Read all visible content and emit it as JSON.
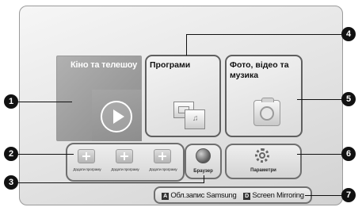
{
  "tiles": {
    "movies": {
      "title": "Кіно та телешоу"
    },
    "apps": {
      "title": "Програми"
    },
    "photos": {
      "title": "Фото, відео та музика"
    }
  },
  "add_apps": [
    {
      "label": "Додати програму"
    },
    {
      "label": "Додати програму"
    },
    {
      "label": "Додати програму"
    }
  ],
  "browser": {
    "label": "Браузер"
  },
  "settings": {
    "label": "Параметри"
  },
  "bottom_bar": {
    "item_a": {
      "key": "A",
      "label": "Обл.запис Samsung"
    },
    "item_d": {
      "key": "D",
      "label": "Screen Mirroring"
    }
  },
  "callouts": [
    "1",
    "2",
    "3",
    "4",
    "5",
    "6",
    "7"
  ]
}
